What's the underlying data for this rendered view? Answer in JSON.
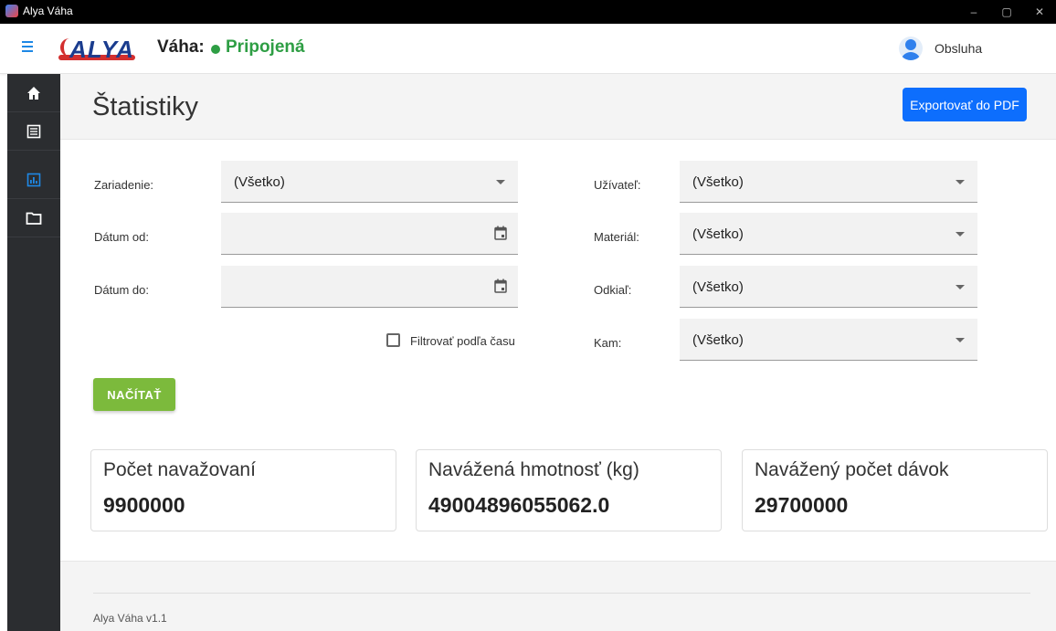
{
  "window": {
    "title": "Alya Váha",
    "controls": {
      "minimize": "–",
      "maximize": "▢",
      "close": "✕"
    }
  },
  "header": {
    "logo_text": "ALYA",
    "scale_label": "Váha:",
    "status_text": "Pripojená",
    "status_color": "#2e9e44",
    "user_name": "Obsluha"
  },
  "sidebar": {
    "items": [
      {
        "icon": "home-icon",
        "active": false
      },
      {
        "icon": "list-icon",
        "active": false
      },
      {
        "icon": "chart-icon",
        "active": true
      },
      {
        "icon": "folder-icon",
        "active": false
      }
    ],
    "active_color": "#1e88e5"
  },
  "page": {
    "title": "Štatistiky",
    "export_label": "Exportovať do PDF"
  },
  "filters": {
    "device": {
      "label": "Zariadenie:",
      "value": "(Všetko)"
    },
    "date_from": {
      "label": "Dátum od:",
      "value": ""
    },
    "date_to": {
      "label": "Dátum do:",
      "value": ""
    },
    "time_filter": {
      "label": "Filtrovať podľa času",
      "checked": false
    },
    "user": {
      "label": "Užívateľ:",
      "value": "(Všetko)"
    },
    "material": {
      "label": "Materiál:",
      "value": "(Všetko)"
    },
    "from": {
      "label": "Odkiaľ:",
      "value": "(Všetko)"
    },
    "to": {
      "label": "Kam:",
      "value": "(Všetko)"
    },
    "load_label": "NAČÍTAŤ"
  },
  "stats": [
    {
      "title": "Počet navažovaní",
      "value": "9900000"
    },
    {
      "title": "Navážená hmotnosť (kg)",
      "value": "49004896055062.0"
    },
    {
      "title": "Navážený počet dávok",
      "value": "29700000"
    }
  ],
  "footer": {
    "text": "Alya Váha v1.1"
  }
}
